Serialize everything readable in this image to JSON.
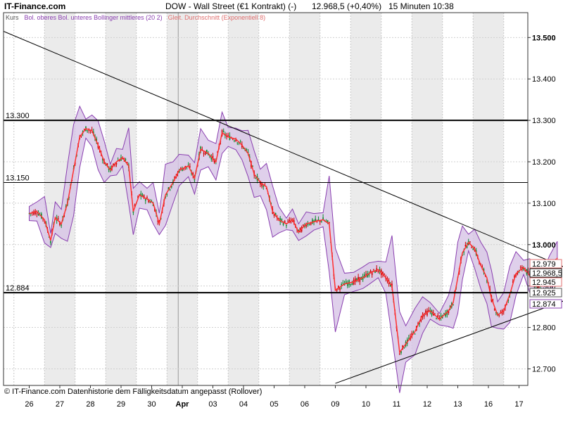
{
  "header": {
    "site": "IT-Finance.com",
    "title": "DOW - Wall Street (€1 Kontrakt) (-)",
    "price_change": "12.968,5 (+0,40%)",
    "interval_time": "15 Minuten  10:38"
  },
  "footer": {
    "copyright": "© IT-Finance.com  Datenhistorie dem Fälligkeitsdatum angepasst (Rollover)"
  },
  "chart_data": {
    "type": "candlestick",
    "legend": [
      {
        "label": "Kurs",
        "color": "#555555"
      },
      {
        "label": "Bol. oberes Bol. unteres Bollinger mittleres (20 2)",
        "color": "#8a3fb0"
      },
      {
        "label": "Gleit. Durchschnitt (Exponentiell 8)",
        "color": "#e07070"
      }
    ],
    "y_ticks": [
      12700,
      12800,
      12900,
      13000,
      13100,
      13200,
      13300,
      13400,
      13500
    ],
    "y_tick_labels": [
      "12.700",
      "12.800",
      "12.900",
      "13.000",
      "13.100",
      "13.200",
      "13.300",
      "13.400",
      "13.500"
    ],
    "ylim": [
      12660,
      13560
    ],
    "x_labels": [
      "26",
      "27",
      "28",
      "29",
      "30",
      "Apr",
      "03",
      "04",
      "05",
      "06",
      "09",
      "10",
      "11",
      "12",
      "13",
      "16",
      "17"
    ],
    "support_levels": [
      {
        "label": "13.300",
        "value": 13300,
        "bold": true
      },
      {
        "label": "13.150",
        "value": 13150,
        "bold": false
      },
      {
        "label": "12.884",
        "value": 12884,
        "bold": true
      }
    ],
    "trend_lines": [
      {
        "x1": 0,
        "y1": 13515,
        "x2": 17.45,
        "y2": 12945
      },
      {
        "x1": 10.0,
        "y1": 12665,
        "x2": 17.45,
        "y2": 12865
      }
    ],
    "price_tags": [
      {
        "label": "12.979",
        "value": 12979,
        "color": "#e07070"
      },
      {
        "label": "12.968,5",
        "value": 12968.5,
        "color": "#000000"
      },
      {
        "label": "12.945",
        "value": 12945,
        "color": "#e07070"
      },
      {
        "label": "12.925",
        "value": 12925,
        "color": "#555555"
      },
      {
        "label": "12.874",
        "value": 12874,
        "color": "#8a3fb0"
      }
    ],
    "price_path": [
      [
        0.0,
        13075
      ],
      [
        0.25,
        13080
      ],
      [
        0.5,
        13060
      ],
      [
        0.7,
        13010
      ],
      [
        0.85,
        13065
      ],
      [
        1.05,
        13050
      ],
      [
        1.25,
        13100
      ],
      [
        1.45,
        13180
      ],
      [
        1.65,
        13260
      ],
      [
        1.85,
        13280
      ],
      [
        2.05,
        13275
      ],
      [
        2.25,
        13240
      ],
      [
        2.45,
        13200
      ],
      [
        2.65,
        13180
      ],
      [
        2.85,
        13200
      ],
      [
        3.05,
        13210
      ],
      [
        3.25,
        13190
      ],
      [
        3.4,
        13080
      ],
      [
        3.6,
        13120
      ],
      [
        3.85,
        13110
      ],
      [
        4.05,
        13100
      ],
      [
        4.25,
        13050
      ],
      [
        4.45,
        13120
      ],
      [
        4.7,
        13150
      ],
      [
        4.9,
        13180
      ],
      [
        5.2,
        13190
      ],
      [
        5.4,
        13160
      ],
      [
        5.6,
        13230
      ],
      [
        5.85,
        13220
      ],
      [
        6.1,
        13200
      ],
      [
        6.3,
        13270
      ],
      [
        6.5,
        13260
      ],
      [
        6.75,
        13255
      ],
      [
        6.95,
        13240
      ],
      [
        7.15,
        13220
      ],
      [
        7.35,
        13170
      ],
      [
        7.55,
        13150
      ],
      [
        7.75,
        13140
      ],
      [
        7.95,
        13080
      ],
      [
        8.15,
        13060
      ],
      [
        8.4,
        13050
      ],
      [
        8.6,
        13060
      ],
      [
        8.8,
        13030
      ],
      [
        9.05,
        13050
      ],
      [
        9.3,
        13055
      ],
      [
        9.6,
        13060
      ],
      [
        9.8,
        13050
      ],
      [
        10.0,
        12890
      ],
      [
        10.3,
        12905
      ],
      [
        10.6,
        12910
      ],
      [
        10.9,
        12920
      ],
      [
        11.1,
        12930
      ],
      [
        11.4,
        12940
      ],
      [
        11.65,
        12920
      ],
      [
        11.85,
        12900
      ],
      [
        12.1,
        12740
      ],
      [
        12.3,
        12760
      ],
      [
        12.6,
        12790
      ],
      [
        12.85,
        12830
      ],
      [
        13.1,
        12840
      ],
      [
        13.4,
        12820
      ],
      [
        13.7,
        12840
      ],
      [
        13.85,
        12860
      ],
      [
        14.0,
        12920
      ],
      [
        14.15,
        12980
      ],
      [
        14.35,
        13005
      ],
      [
        14.55,
        12990
      ],
      [
        14.75,
        12950
      ],
      [
        14.95,
        12920
      ],
      [
        15.1,
        12870
      ],
      [
        15.3,
        12830
      ],
      [
        15.5,
        12840
      ],
      [
        15.7,
        12880
      ],
      [
        15.9,
        12930
      ],
      [
        16.15,
        12945
      ],
      [
        16.35,
        12925
      ],
      [
        16.6,
        12900
      ],
      [
        16.8,
        12910
      ],
      [
        17.0,
        12925
      ],
      [
        17.25,
        12968
      ]
    ]
  }
}
